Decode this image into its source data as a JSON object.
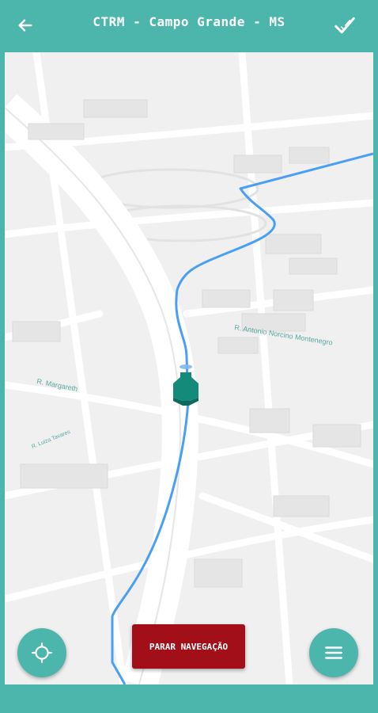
{
  "header": {
    "title": "CTRM - Campo Grande - MS",
    "back_icon": "arrow-left-icon",
    "confirm_icon": "check-icon"
  },
  "map": {
    "street_labels": [
      "R. Antonio Norcino Montenegro",
      "R. Margareth",
      "R. Luiza Tavares"
    ],
    "route_color": "#4A9FF5",
    "vehicle_color": "#148A7A",
    "accent_color": "#4DB6AC"
  },
  "controls": {
    "stop_navigation_label": "PARAR NAVEGAÇÃO",
    "locate_icon": "crosshair-icon",
    "menu_icon": "hamburger-menu-icon"
  }
}
